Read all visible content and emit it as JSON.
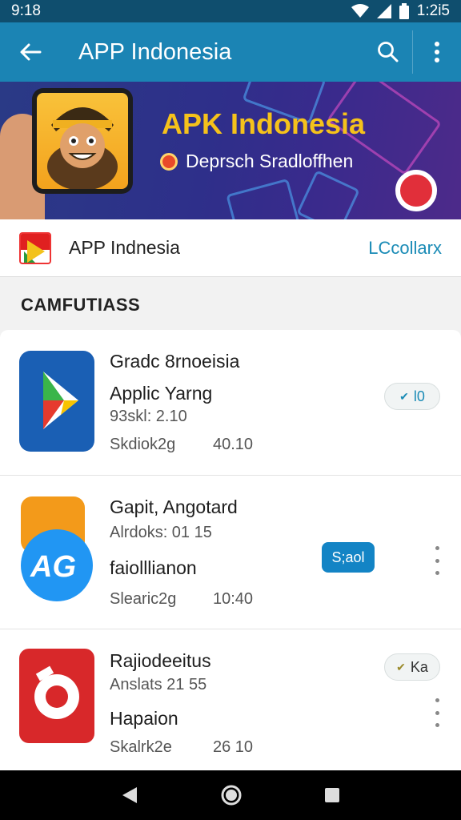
{
  "status": {
    "time": "9:18",
    "right_time": "1:2i5"
  },
  "appbar": {
    "title": "APP Indonesia"
  },
  "banner": {
    "headline": "APK Indonesia",
    "subtitle": "Deprsch Sradloffhen"
  },
  "appinfo": {
    "name": "APP Indnesia",
    "link": "LCcollarx"
  },
  "section": {
    "title": "CAMFUTIASS"
  },
  "items": [
    {
      "title": "Gradc 8rnoeisia",
      "line2": "Applic Yarng",
      "line3": "93skl: 2.10",
      "line4": "Skdiok2g",
      "num": "40.10",
      "action": "l0",
      "action_type": "pill-check",
      "icon": "play-store-icon",
      "color": "#1565c0"
    },
    {
      "title": "Gapit, Angotard",
      "line2": "Alrdoks: 01 15",
      "line3": "faiolllianon",
      "line4": "Slearic2g",
      "num": "10:40",
      "action": "S;aol",
      "action_type": "button-blue",
      "icon": "ag-icon",
      "color": "#1e88e5"
    },
    {
      "title": "Rajiodeeitus",
      "line2": "Anslats 21 55",
      "line3": "Hapaion",
      "line4": "Skalrk2e",
      "num": "26 10",
      "action": "Ka",
      "action_type": "pill-check",
      "icon": "lens-icon",
      "color": "#d8282a"
    }
  ]
}
